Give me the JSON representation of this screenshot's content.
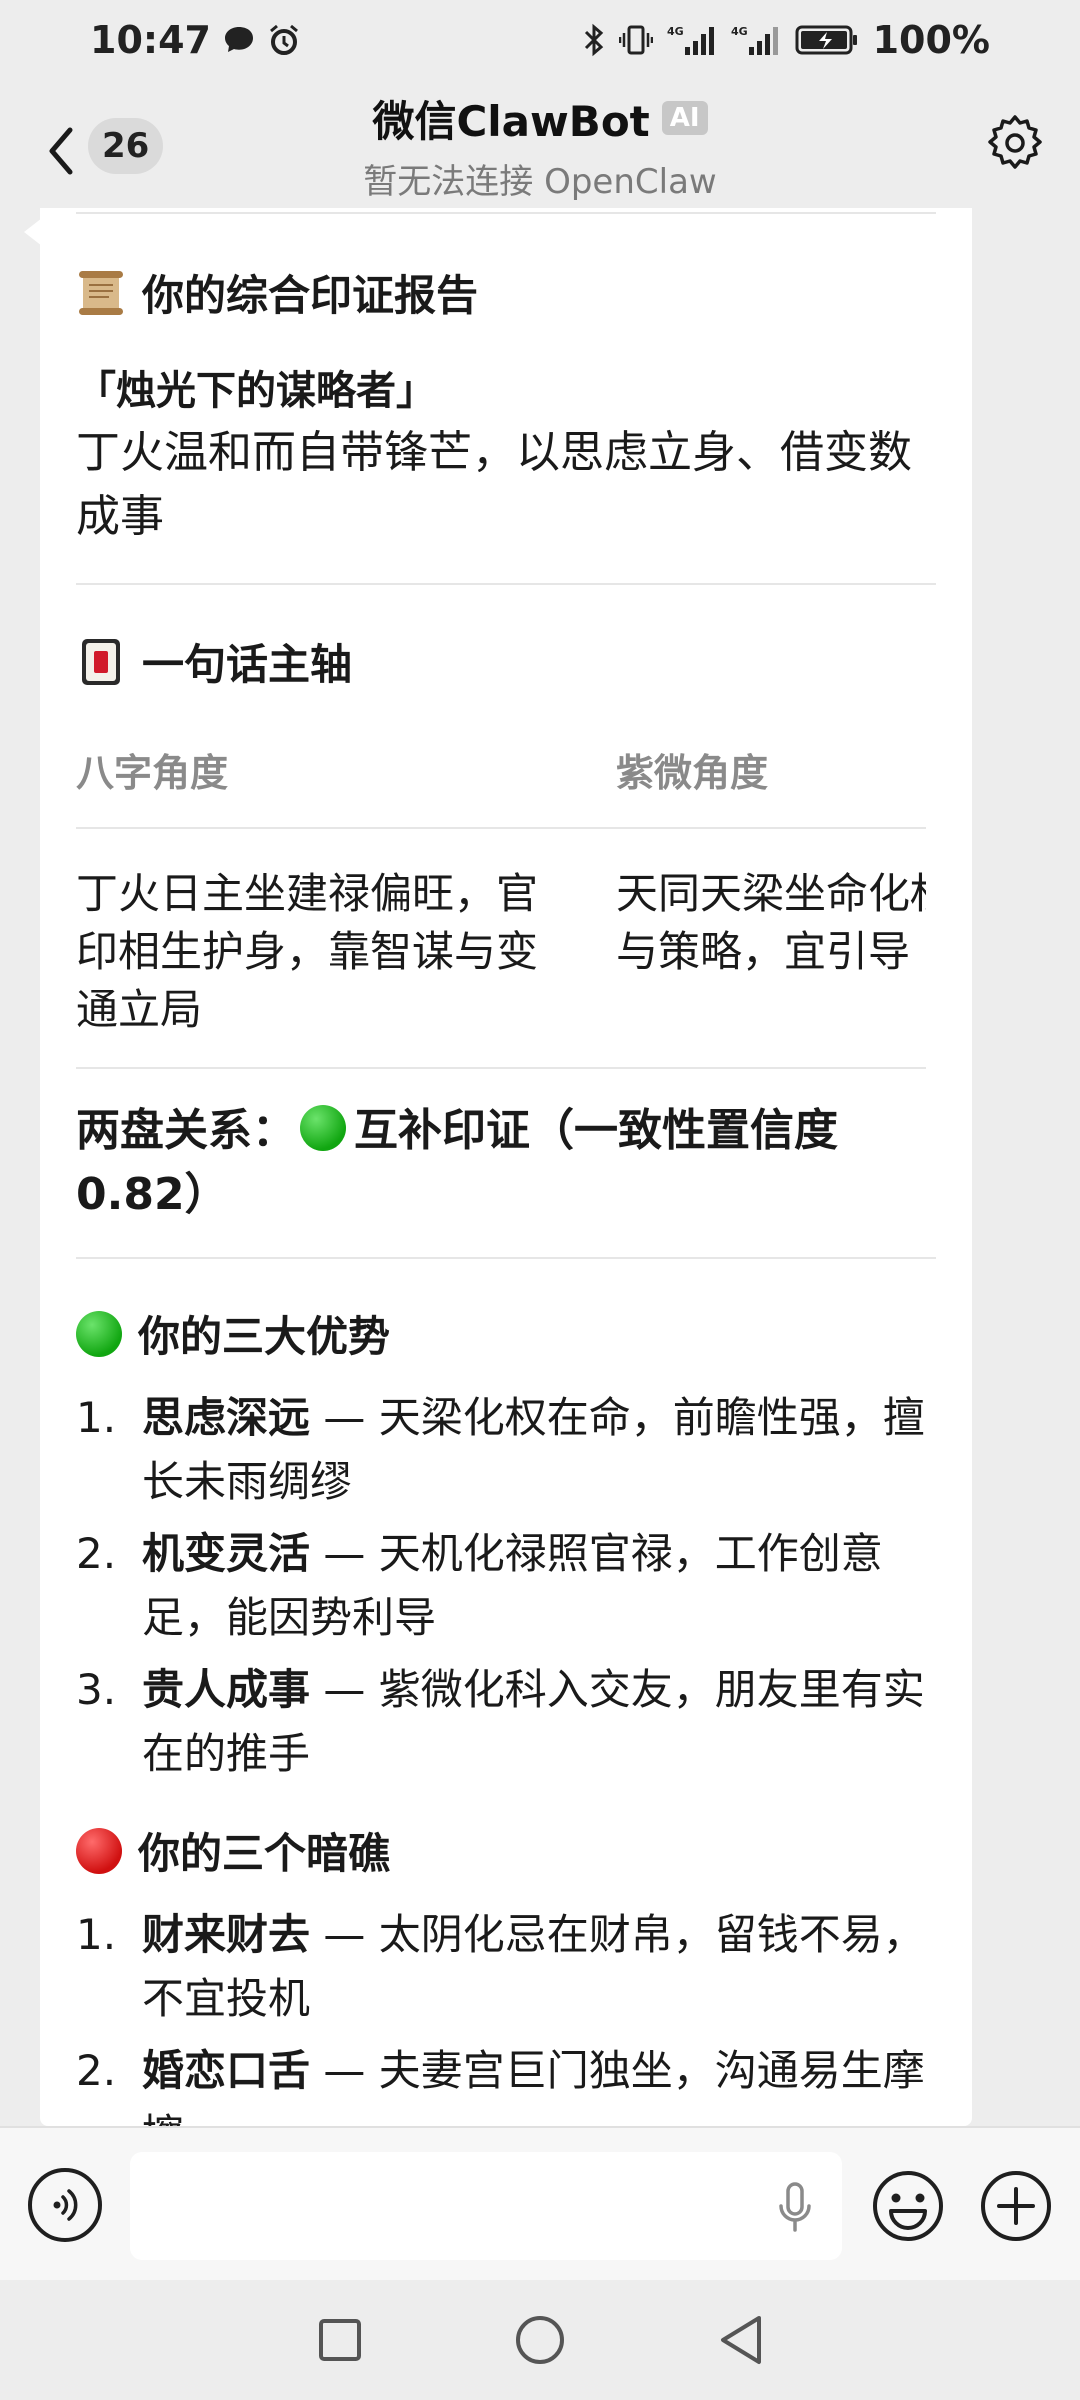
{
  "status_bar": {
    "time": "10:47",
    "battery": "100%",
    "icons": [
      "chat-bubble-icon",
      "alarm-icon",
      "bluetooth-icon",
      "vibrate-icon",
      "signal-4g-icon",
      "signal-4g-icon",
      "battery-charging-icon"
    ]
  },
  "header": {
    "unread_count": "26",
    "title": "微信ClawBot",
    "ai_badge": "AI",
    "subtitle": "暂无法连接 OpenClaw"
  },
  "message": {
    "report": {
      "emoji": "scroll-icon",
      "title": "你的综合印证报告",
      "quote": "「烛光下的谋略者」",
      "body": "丁火温和而自带锋芒，以思虑立身、借变数成事"
    },
    "axis": {
      "emoji": "mahjong-icon",
      "title": "一句话主轴",
      "columns": [
        "八字角度",
        "紫微角度"
      ],
      "cells": [
        "丁火日主坐建禄偏旺，官印相生护身，靠智谋与变通立局",
        "天同天梁坐命化权，大脑与策略，宜引导"
      ]
    },
    "relation": {
      "label": "两盘关系：",
      "value": "互补印证（一致性置信度 0.82）"
    },
    "advantages": {
      "title": "你的三大优势",
      "items": [
        {
          "num": "1.",
          "bold": "思虑深远",
          "text": " — 天梁化权在命，前瞻性强，擅长未雨绸缪"
        },
        {
          "num": "2.",
          "bold": "机变灵活",
          "text": " — 天机化禄照官禄，工作创意足，能因势利导"
        },
        {
          "num": "3.",
          "bold": "贵人成事",
          "text": " — 紫微化科入交友，朋友里有实在的推手"
        }
      ]
    },
    "risks": {
      "title": "你的三个暗礁",
      "items": [
        {
          "num": "1.",
          "bold": "财来财去",
          "text": " — 太阴化忌在财帛，留钱不易，不宜投机"
        },
        {
          "num": "2.",
          "bold": "婚恋口舌",
          "text": " — 夫妻宫巨门独坐，沟通易生摩擦"
        }
      ]
    }
  },
  "input_bar": {
    "placeholder": ""
  },
  "colors": {
    "background": "#ededed",
    "bubble": "#ffffff",
    "green_dot": "#11a611",
    "red_dot": "#d01010"
  }
}
